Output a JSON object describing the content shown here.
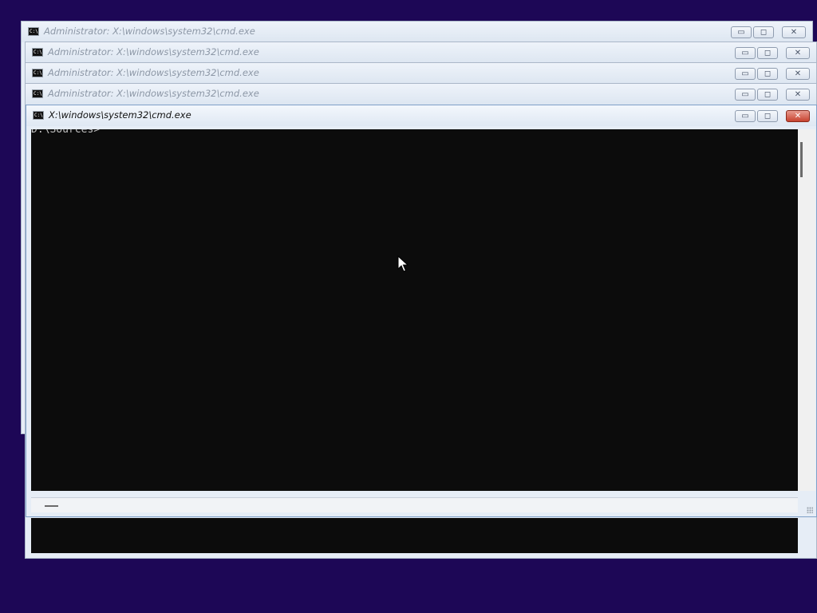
{
  "windows": [
    {
      "title": "Administrator: X:\\windows\\system32\\cmd.exe",
      "icon": "cmd-icon",
      "icon_text": "C:\\."
    },
    {
      "title": "Administrator: X:\\windows\\system32\\cmd.exe",
      "icon": "cmd-icon",
      "icon_text": "C:\\."
    },
    {
      "title": "Administrator: X:\\windows\\system32\\cmd.exe",
      "icon": "cmd-icon",
      "icon_text": "C:\\."
    },
    {
      "title": "Administrator: X:\\windows\\system32\\cmd.exe",
      "icon": "cmd-icon",
      "icon_text": "C:\\."
    }
  ],
  "active_window": {
    "title": "X:\\windows\\system32\\cmd.exe",
    "icon": "cmd-icon",
    "icon_text": "C:\\.",
    "console_text": "D:\\Sources>"
  },
  "controls": {
    "minimize": "▭",
    "maximize": "◻",
    "close": "✕"
  },
  "colors": {
    "desktop": "#1d0756",
    "console_bg": "#0c0c0c",
    "console_fg": "#c0c0c0",
    "close_button_active": "#c7432f"
  }
}
